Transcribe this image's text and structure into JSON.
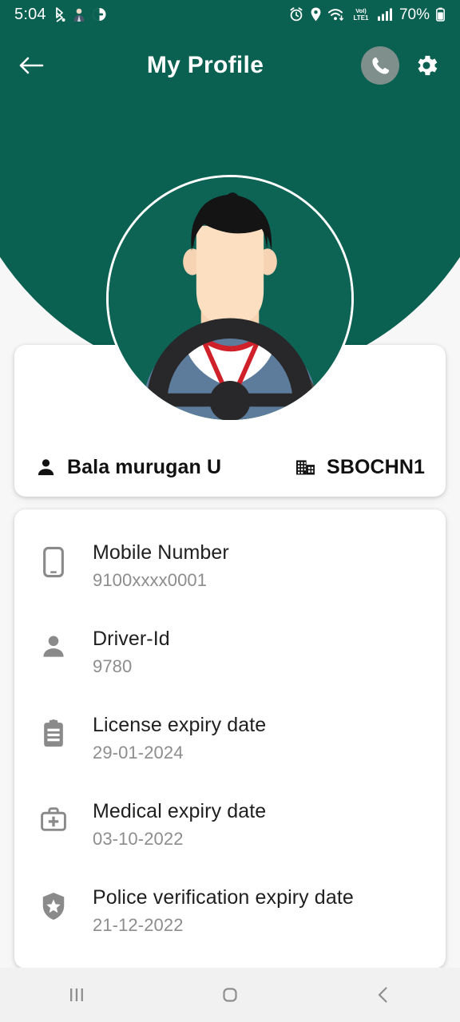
{
  "statusbar": {
    "time": "5:04",
    "battery_text": "70%",
    "network_label": "LTE1",
    "volte_label": "VoI)",
    "left_icons": [
      "bluetooth-location-icon",
      "person-app-icon",
      "dnd-icon"
    ],
    "right_icons": [
      "alarm-icon",
      "location-pin-icon",
      "wifi-icon",
      "volte-icon",
      "signal-bars-icon",
      "battery-icon"
    ]
  },
  "appbar": {
    "title": "My Profile",
    "back_icon": "arrow-left-icon",
    "call_icon": "phone-icon",
    "settings_icon": "gear-icon"
  },
  "profile": {
    "avatar_alt": "driver-avatar-illustration",
    "name": "Bala murugan U",
    "name_icon": "person-icon",
    "depot": "SBOCHN1",
    "depot_icon": "building-icon"
  },
  "details": [
    {
      "icon": "mobile-phone-icon",
      "label": "Mobile Number",
      "value": "9100xxxx0001"
    },
    {
      "icon": "person-icon",
      "label": "Driver-Id",
      "value": "9780"
    },
    {
      "icon": "clipboard-icon",
      "label": "License expiry date",
      "value": "29-01-2024"
    },
    {
      "icon": "medical-kit-icon",
      "label": "Medical expiry date",
      "value": "03-10-2022"
    },
    {
      "icon": "shield-star-icon",
      "label": "Police verification expiry date",
      "value": "21-12-2022"
    }
  ],
  "navbar": {
    "recents_icon": "recents-icon",
    "home_icon": "home-icon",
    "back_icon": "back-chevron-icon"
  },
  "colors": {
    "brand_green": "#0a6051",
    "card_white": "#ffffff",
    "page_bg": "#f7f7f7",
    "label_text": "#1f1f1f",
    "value_text": "#8d8d8d",
    "nav_bg": "#f1f1f1",
    "phone_circle": "#7e8f8c"
  }
}
